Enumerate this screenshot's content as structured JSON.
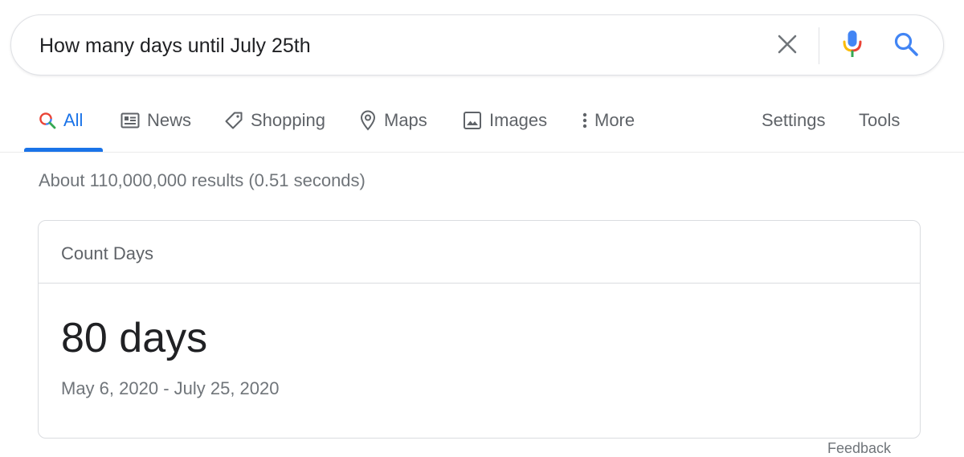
{
  "search": {
    "query": "How many days until July 25th"
  },
  "tabs": [
    {
      "label": "All",
      "icon": "search-icon"
    },
    {
      "label": "News",
      "icon": "news-icon"
    },
    {
      "label": "Shopping",
      "icon": "tag-icon"
    },
    {
      "label": "Maps",
      "icon": "map-pin-icon"
    },
    {
      "label": "Images",
      "icon": "image-icon"
    },
    {
      "label": "More",
      "icon": "more-vert-icon"
    }
  ],
  "tools": {
    "settings_label": "Settings",
    "tools_label": "Tools"
  },
  "results": {
    "stats": "About 110,000,000 results (0.51 seconds)"
  },
  "card": {
    "title": "Count Days",
    "value": "80 days",
    "range": "May 6, 2020 - July 25, 2020"
  },
  "footer": {
    "feedback_label": "Feedback"
  },
  "colors": {
    "accent": "#1a73e8",
    "text_primary": "#202124",
    "text_secondary": "#5f6368",
    "text_muted": "#70757a",
    "border": "#dadce0"
  }
}
